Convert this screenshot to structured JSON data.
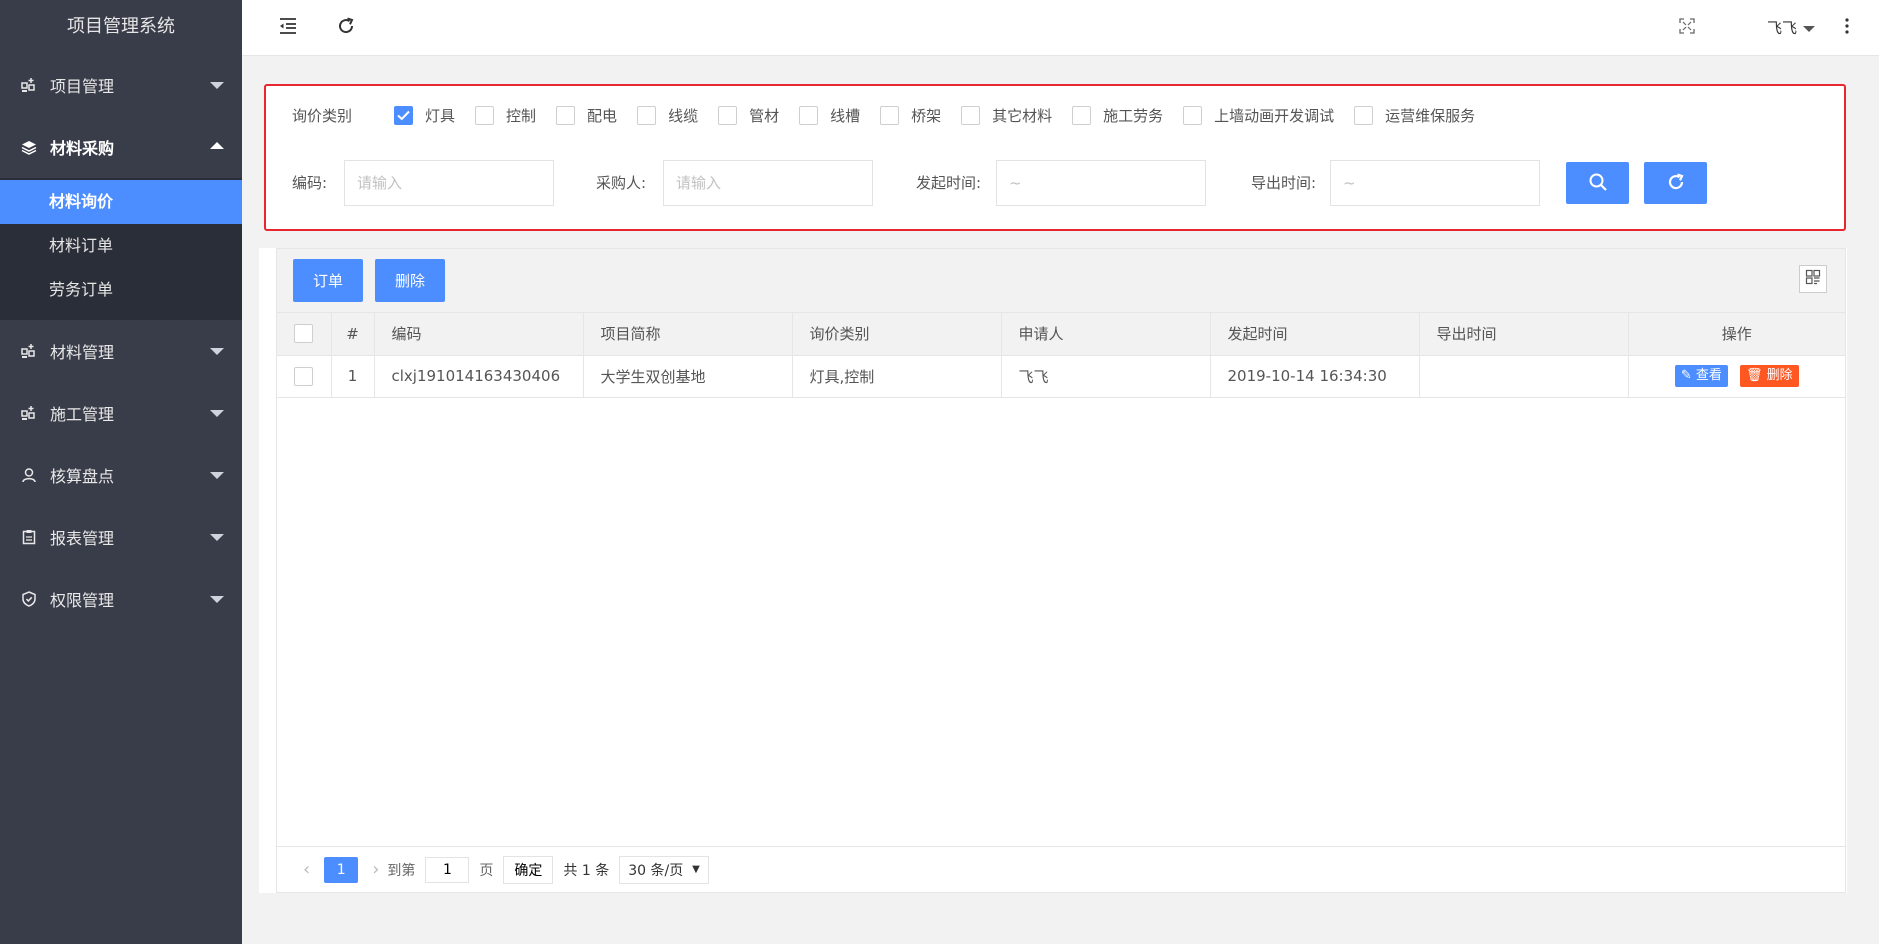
{
  "app": {
    "title": "项目管理系统"
  },
  "sidebar": {
    "items": [
      {
        "label": "项目管理",
        "icon": "grid-plus-icon"
      },
      {
        "label": "材料采购",
        "icon": "layers-icon",
        "open": true
      },
      {
        "label": "材料管理",
        "icon": "grid-plus-icon"
      },
      {
        "label": "施工管理",
        "icon": "grid-plus-icon"
      },
      {
        "label": "核算盘点",
        "icon": "user-icon"
      },
      {
        "label": "报表管理",
        "icon": "clipboard-icon"
      },
      {
        "label": "权限管理",
        "icon": "shield-icon"
      }
    ],
    "sub_items": [
      {
        "label": "材料询价",
        "active": true
      },
      {
        "label": "材料订单"
      },
      {
        "label": "劳务订单"
      }
    ]
  },
  "header": {
    "user": "飞飞"
  },
  "filter": {
    "category_label": "询价类别",
    "categories": [
      {
        "label": "灯具",
        "checked": true
      },
      {
        "label": "控制"
      },
      {
        "label": "配电"
      },
      {
        "label": "线缆"
      },
      {
        "label": "管材"
      },
      {
        "label": "线槽"
      },
      {
        "label": "桥架"
      },
      {
        "label": "其它材料"
      },
      {
        "label": "施工劳务"
      },
      {
        "label": "上墙动画开发调试"
      },
      {
        "label": "运营维保服务"
      }
    ],
    "code_label": "编码:",
    "code_placeholder": "请输入",
    "buyer_label": "采购人:",
    "buyer_placeholder": "请输入",
    "start_label": "发起时间:",
    "start_placeholder": "~",
    "export_label": "导出时间:",
    "export_placeholder": "~"
  },
  "toolbar": {
    "order_label": "订单",
    "delete_label": "删除"
  },
  "table": {
    "columns": [
      "#",
      "编码",
      "项目简称",
      "询价类别",
      "申请人",
      "发起时间",
      "导出时间",
      "操作"
    ],
    "rows": [
      {
        "idx": "1",
        "code": "clxj191014163430406",
        "project": "大学生双创基地",
        "category": "灯具,控制",
        "applicant": "飞飞",
        "start": "2019-10-14 16:34:30",
        "export": "",
        "view_label": "查看",
        "delete_label": "删除"
      }
    ]
  },
  "pager": {
    "current": "1",
    "goto_label": "到第",
    "goto_value": "1",
    "page_label": "页",
    "ok_label": "确定",
    "total": "共 1 条",
    "page_size": "30 条/页"
  },
  "colors": {
    "accent": "#4c8dff",
    "sidebar_bg": "#393d49",
    "danger": "#ff5722",
    "highlight_border": "#e8262f"
  }
}
